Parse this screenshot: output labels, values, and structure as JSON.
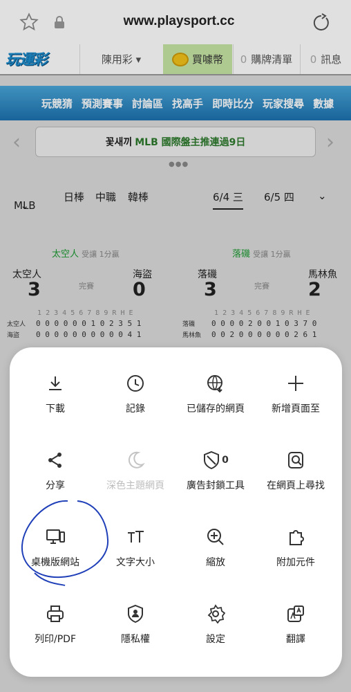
{
  "browser": {
    "url": "www.playsport.cc"
  },
  "site": {
    "logo": "玩運彩",
    "lottery_label": "陳用彩",
    "buy_coin_label": "買噱幣",
    "cart_count": "0",
    "cart_label": "購牌清單",
    "msg_count": "0",
    "msg_label": "訊息"
  },
  "nav": [
    "玩競猜",
    "預測賽事",
    "討論區",
    "找高手",
    "即時比分",
    "玩家搜尋",
    "數據"
  ],
  "marquee": {
    "prefix": "꽃새끼",
    "text": "MLB 國際盤主推連過9日"
  },
  "leagues": {
    "current": "MLB",
    "items": [
      "日棒",
      "中職",
      "韓棒"
    ],
    "date1": "6/4 三",
    "date2": "6/5 四"
  },
  "games": [
    {
      "pick_team": "太空人",
      "pick_note": "受讓 1分贏",
      "away": "太空人",
      "home": "海盜",
      "away_score": "3",
      "home_score": "0",
      "status": "完賽",
      "header": "  1 2 3 4 5 6 7 8 9 R H E",
      "away_line": "0 0 0 0 0 0 1 0 2 3 5 1",
      "home_line": "0 0 0 0 0 0 0 0 0 0 4 1",
      "away_short": "太空人",
      "home_short": "海盜"
    },
    {
      "pick_team": "落磯",
      "pick_note": "受讓 1分贏",
      "away": "落磯",
      "home": "馬林魚",
      "away_score": "3",
      "home_score": "2",
      "status": "完賽",
      "header": "  1 2 3 4 5 6 7 8 9 R H E",
      "away_line": "0 0 0 0 2 0 0 1 0 3 7 0",
      "home_line": "0 0 2 0 0 0 0 0 0 2 6 1",
      "away_short": "落磯",
      "home_short": "馬林魚"
    }
  ],
  "menu": {
    "items": [
      {
        "label": "下載",
        "icon": "download-icon"
      },
      {
        "label": "記錄",
        "icon": "history-icon"
      },
      {
        "label": "已儲存的網頁",
        "icon": "saved-pages-icon"
      },
      {
        "label": "新增頁面至",
        "icon": "plus-icon"
      },
      {
        "label": "分享",
        "icon": "share-icon"
      },
      {
        "label": "深色主題網頁",
        "icon": "moon-icon"
      },
      {
        "label": "廣告封鎖工具",
        "icon": "shield-block-icon",
        "badge": "0"
      },
      {
        "label": "在網頁上尋找",
        "icon": "find-in-page-icon"
      },
      {
        "label": "桌機版網站",
        "icon": "desktop-icon"
      },
      {
        "label": "文字大小",
        "icon": "text-size-icon"
      },
      {
        "label": "縮放",
        "icon": "zoom-icon"
      },
      {
        "label": "附加元件",
        "icon": "puzzle-icon"
      },
      {
        "label": "列印/PDF",
        "icon": "print-icon"
      },
      {
        "label": "隱私權",
        "icon": "privacy-icon"
      },
      {
        "label": "設定",
        "icon": "settings-icon"
      },
      {
        "label": "翻譯",
        "icon": "translate-icon"
      }
    ]
  },
  "colors": {
    "nav_blue": "#1c72b0",
    "green": "#1a9a30",
    "annotation": "#1f3fb8"
  }
}
